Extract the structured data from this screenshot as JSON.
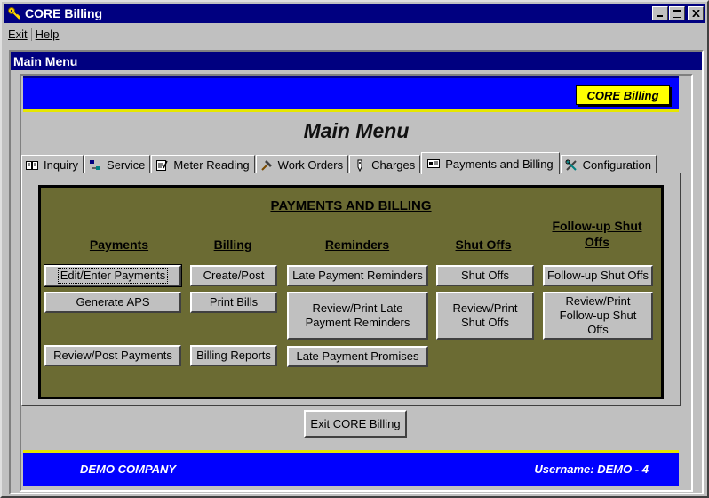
{
  "window": {
    "title": "CORE Billing",
    "app_icon": "key-icon"
  },
  "menubar": {
    "items": [
      "Exit",
      "Help"
    ]
  },
  "child_window": {
    "title": "Main Menu"
  },
  "banner": {
    "badge": "CORE Billing"
  },
  "page_title": "Main Menu",
  "tabs": [
    {
      "label": "Inquiry",
      "icon": "book-icon"
    },
    {
      "label": "Service",
      "icon": "network-icon"
    },
    {
      "label": "Meter Reading",
      "icon": "notepad-icon"
    },
    {
      "label": "Work Orders",
      "icon": "hammer-icon"
    },
    {
      "label": "Charges",
      "icon": "tag-icon"
    },
    {
      "label": "Payments and Billing",
      "icon": "card-icon",
      "active": true
    },
    {
      "label": "Configuration",
      "icon": "tools-icon"
    }
  ],
  "section": {
    "title": "PAYMENTS AND BILLING",
    "columns": {
      "payments": "Payments",
      "billing": "Billing",
      "reminders": "Reminders",
      "shutoffs": "Shut Offs",
      "followup": "Follow-up Shut Offs"
    },
    "buttons": {
      "edit_enter_payments": "Edit/Enter Payments",
      "generate_aps": "Generate APS",
      "review_post_payments": "Review/Post Payments",
      "create_post": "Create/Post",
      "print_bills": "Print  Bills",
      "billing_reports": "Billing Reports",
      "late_payment_reminders": "Late Payment Reminders",
      "review_print_late_reminders": "Review/Print Late Payment Reminders",
      "late_payment_promises": "Late Payment Promises",
      "shut_offs": "Shut Offs",
      "review_print_shut_offs": "Review/Print Shut Offs",
      "followup_shut_offs": "Follow-up Shut Offs",
      "review_print_followup": "Review/Print Follow-up Shut Offs"
    }
  },
  "exit_button": "Exit CORE Billing",
  "status": {
    "company": "DEMO COMPANY",
    "username": "Username: DEMO - 4"
  }
}
